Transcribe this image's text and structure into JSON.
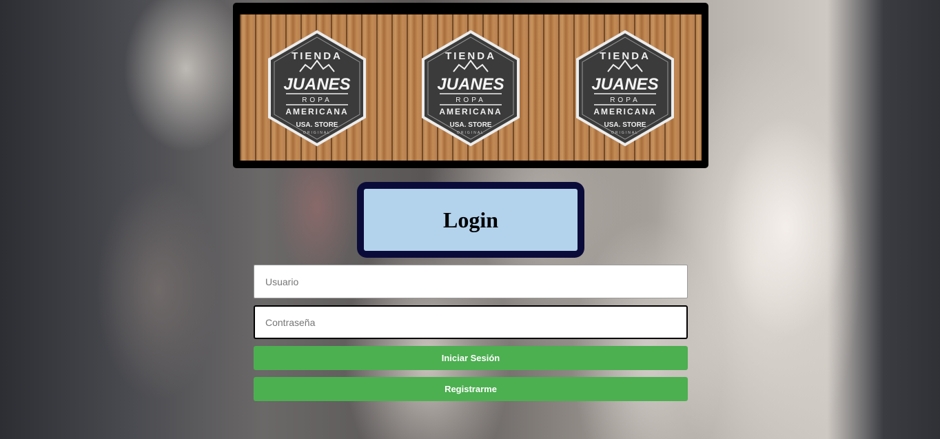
{
  "banner": {
    "logo": {
      "top_text": "TIENDA",
      "brand": "JUANES",
      "line1": "ROPA",
      "line2": "AMERICANA",
      "line3": "USA. STORE",
      "line4": "ORIGINAL"
    },
    "logo_count": 3
  },
  "login": {
    "title": "Login",
    "username_placeholder": "Usuario",
    "password_placeholder": "Contraseña",
    "login_button": "Iniciar Sesión",
    "register_button": "Registrarme"
  },
  "colors": {
    "login_box_border": "#0b0b3a",
    "login_box_fill": "#b3d2ec",
    "button": "#4caf50",
    "badge": "#3b3b3b"
  }
}
